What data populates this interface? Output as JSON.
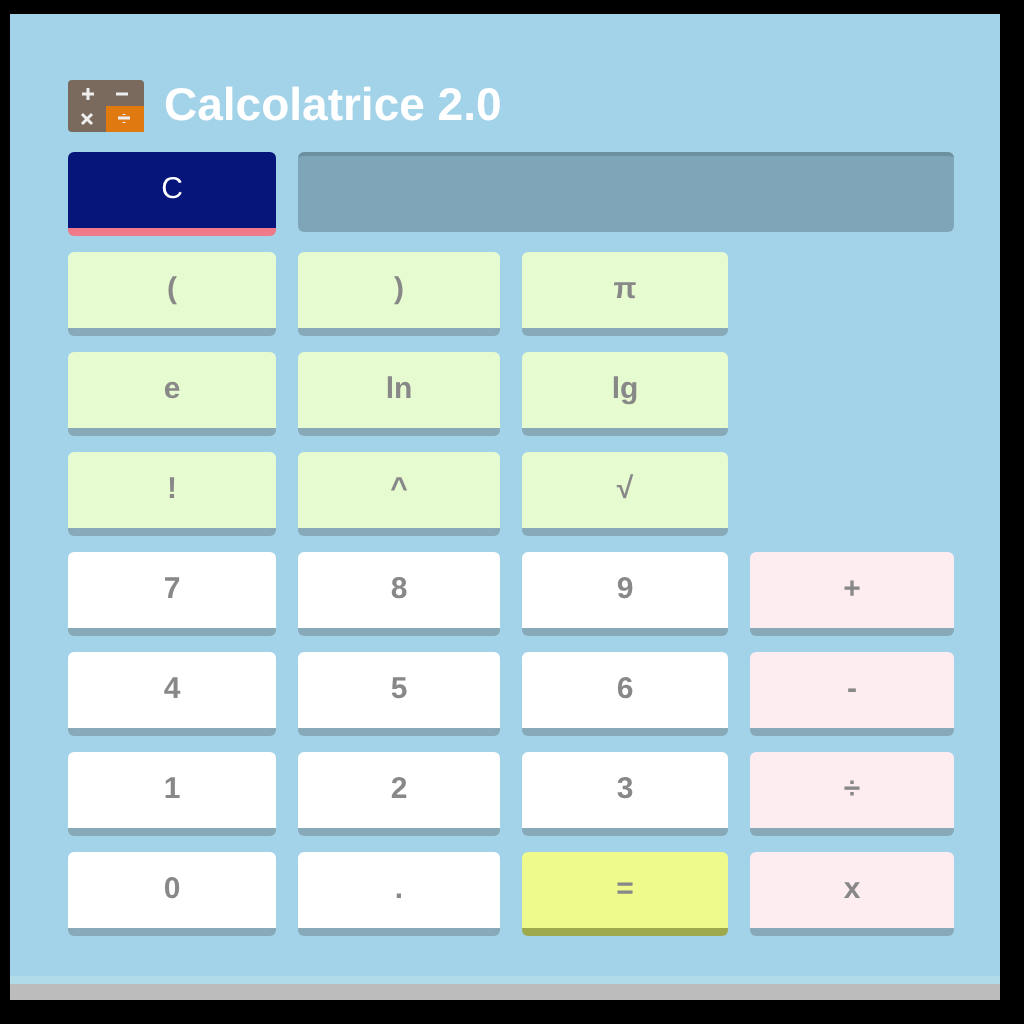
{
  "title": "Calcolatrice 2.0",
  "keys": [
    [
      {
        "label": "C",
        "kind": "clear"
      },
      {
        "kind": "display"
      }
    ],
    [
      {
        "label": "(",
        "kind": "function"
      },
      {
        "label": ")",
        "kind": "function"
      },
      {
        "label": "π",
        "kind": "function"
      }
    ],
    [
      {
        "label": "e",
        "kind": "function"
      },
      {
        "label": "ln",
        "kind": "function"
      },
      {
        "label": "lg",
        "kind": "function"
      }
    ],
    [
      {
        "label": "!",
        "kind": "function"
      },
      {
        "label": "^",
        "kind": "function"
      },
      {
        "label": "√",
        "kind": "function"
      }
    ],
    [
      {
        "label": "7",
        "kind": "digit"
      },
      {
        "label": "8",
        "kind": "digit"
      },
      {
        "label": "9",
        "kind": "digit"
      },
      {
        "label": "+",
        "kind": "operator"
      }
    ],
    [
      {
        "label": "4",
        "kind": "digit"
      },
      {
        "label": "5",
        "kind": "digit"
      },
      {
        "label": "6",
        "kind": "digit"
      },
      {
        "label": "-",
        "kind": "operator"
      }
    ],
    [
      {
        "label": "1",
        "kind": "digit"
      },
      {
        "label": "2",
        "kind": "digit"
      },
      {
        "label": "3",
        "kind": "digit"
      },
      {
        "label": "÷",
        "kind": "operator"
      }
    ],
    [
      {
        "label": "0",
        "kind": "digit"
      },
      {
        "label": ".",
        "kind": "digit"
      },
      {
        "label": "=",
        "kind": "equals"
      },
      {
        "label": "x",
        "kind": "operator"
      }
    ]
  ]
}
